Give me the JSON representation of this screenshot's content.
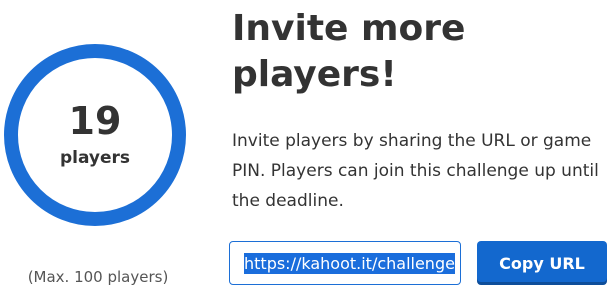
{
  "player_count": {
    "value": "19",
    "unit": "players",
    "max_note": "(Max. 100 players)"
  },
  "invite": {
    "heading": "Invite more players!",
    "description": "Invite players by sharing the URL or game PIN. Players can join this challenge up until the deadline."
  },
  "share": {
    "url_value": "https://kahoot.it/challenge",
    "copy_label": "Copy URL"
  },
  "colors": {
    "accent": "#1368ce",
    "ring": "#1c6fd6",
    "text": "#333333"
  }
}
